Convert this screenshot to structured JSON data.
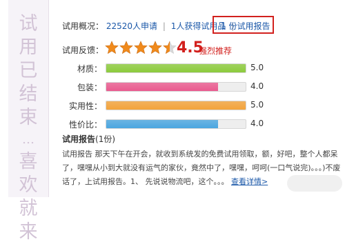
{
  "sidebar": {
    "status_chars": [
      "试",
      "用",
      "已",
      "结",
      "束",
      "…",
      "喜",
      "欢",
      "就",
      "来"
    ]
  },
  "overview": {
    "label": "试用概况：",
    "applicants_num": "22520",
    "applicants_suffix": "人申请",
    "winners": "1人获得试用品",
    "report": "1 份试用报告"
  },
  "feedback": {
    "label": "试用反馈：",
    "stars": 4.5,
    "score": "4.5",
    "recommend": "强烈推荐"
  },
  "ratings": [
    {
      "label": "材质：",
      "value": "5.0",
      "fraction": 1.0,
      "color": "#8ccb3c"
    },
    {
      "label": "包装：",
      "value": "4.0",
      "fraction": 0.8,
      "color": "#ea5a8f"
    },
    {
      "label": "实用性：",
      "value": "5.0",
      "fraction": 1.0,
      "color": "#f3a33a"
    },
    {
      "label": "性价比：",
      "value": "4.0",
      "fraction": 0.8,
      "color": "#4aa6e0"
    }
  ],
  "report_section": {
    "title": "试用报告",
    "count": "(1份)",
    "body": "试用报告  那天下午在开会，就收到系统发的免费试用领取，额，好吧，整个人都呆了，嘿嘿从小到大就没有运气的家伙，竟然中了，嘿嘿，呵呵(一口气说完)。。。)不废话了，上试用报告。1、 先说说物流吧，这个。。。",
    "more": "查看详情>"
  },
  "colors": {
    "accent_red": "#d2201d",
    "link_blue": "#1a57a8",
    "star_orange": "#f08a1c"
  }
}
